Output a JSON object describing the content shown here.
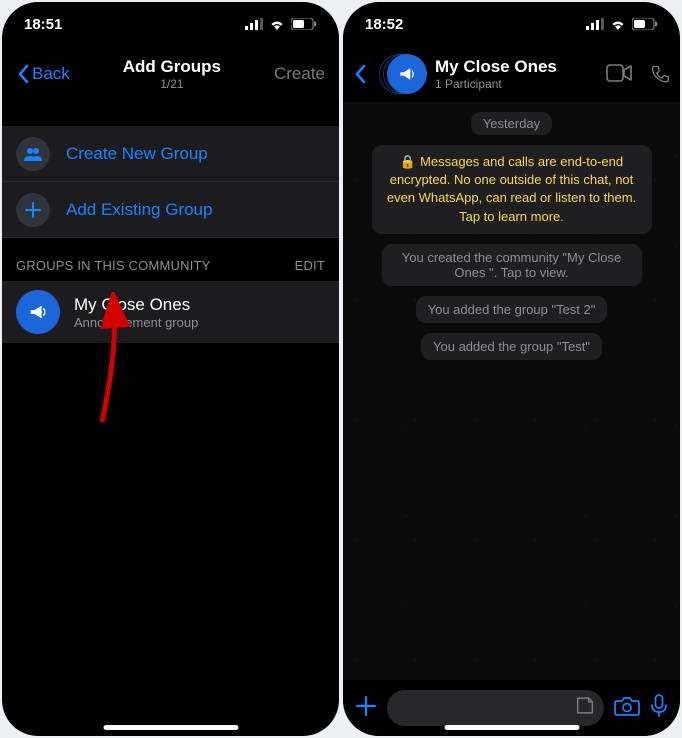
{
  "left": {
    "status_time": "18:51",
    "nav": {
      "back": "Back",
      "title": "Add Groups",
      "subtitle": "1/21",
      "create": "Create"
    },
    "actions": {
      "create_group": "Create New Group",
      "add_existing": "Add Existing Group"
    },
    "section": {
      "title": "GROUPS IN THIS COMMUNITY",
      "edit": "EDIT"
    },
    "group": {
      "name": "My Close Ones",
      "subtitle": "Announcement group"
    }
  },
  "right": {
    "status_time": "18:52",
    "chat": {
      "title": "My Close Ones",
      "subtitle": "1 Participant"
    },
    "date_pill": "Yesterday",
    "encryption_msg": "Messages and calls are end-to-end encrypted. No one outside of this chat, not even WhatsApp, can read or listen to them. Tap to learn more.",
    "sys1": "You created the community \"My Close Ones \". Tap to view.",
    "sys2": "You added the group \"Test 2\"",
    "sys3": "You added the group \"Test\""
  }
}
